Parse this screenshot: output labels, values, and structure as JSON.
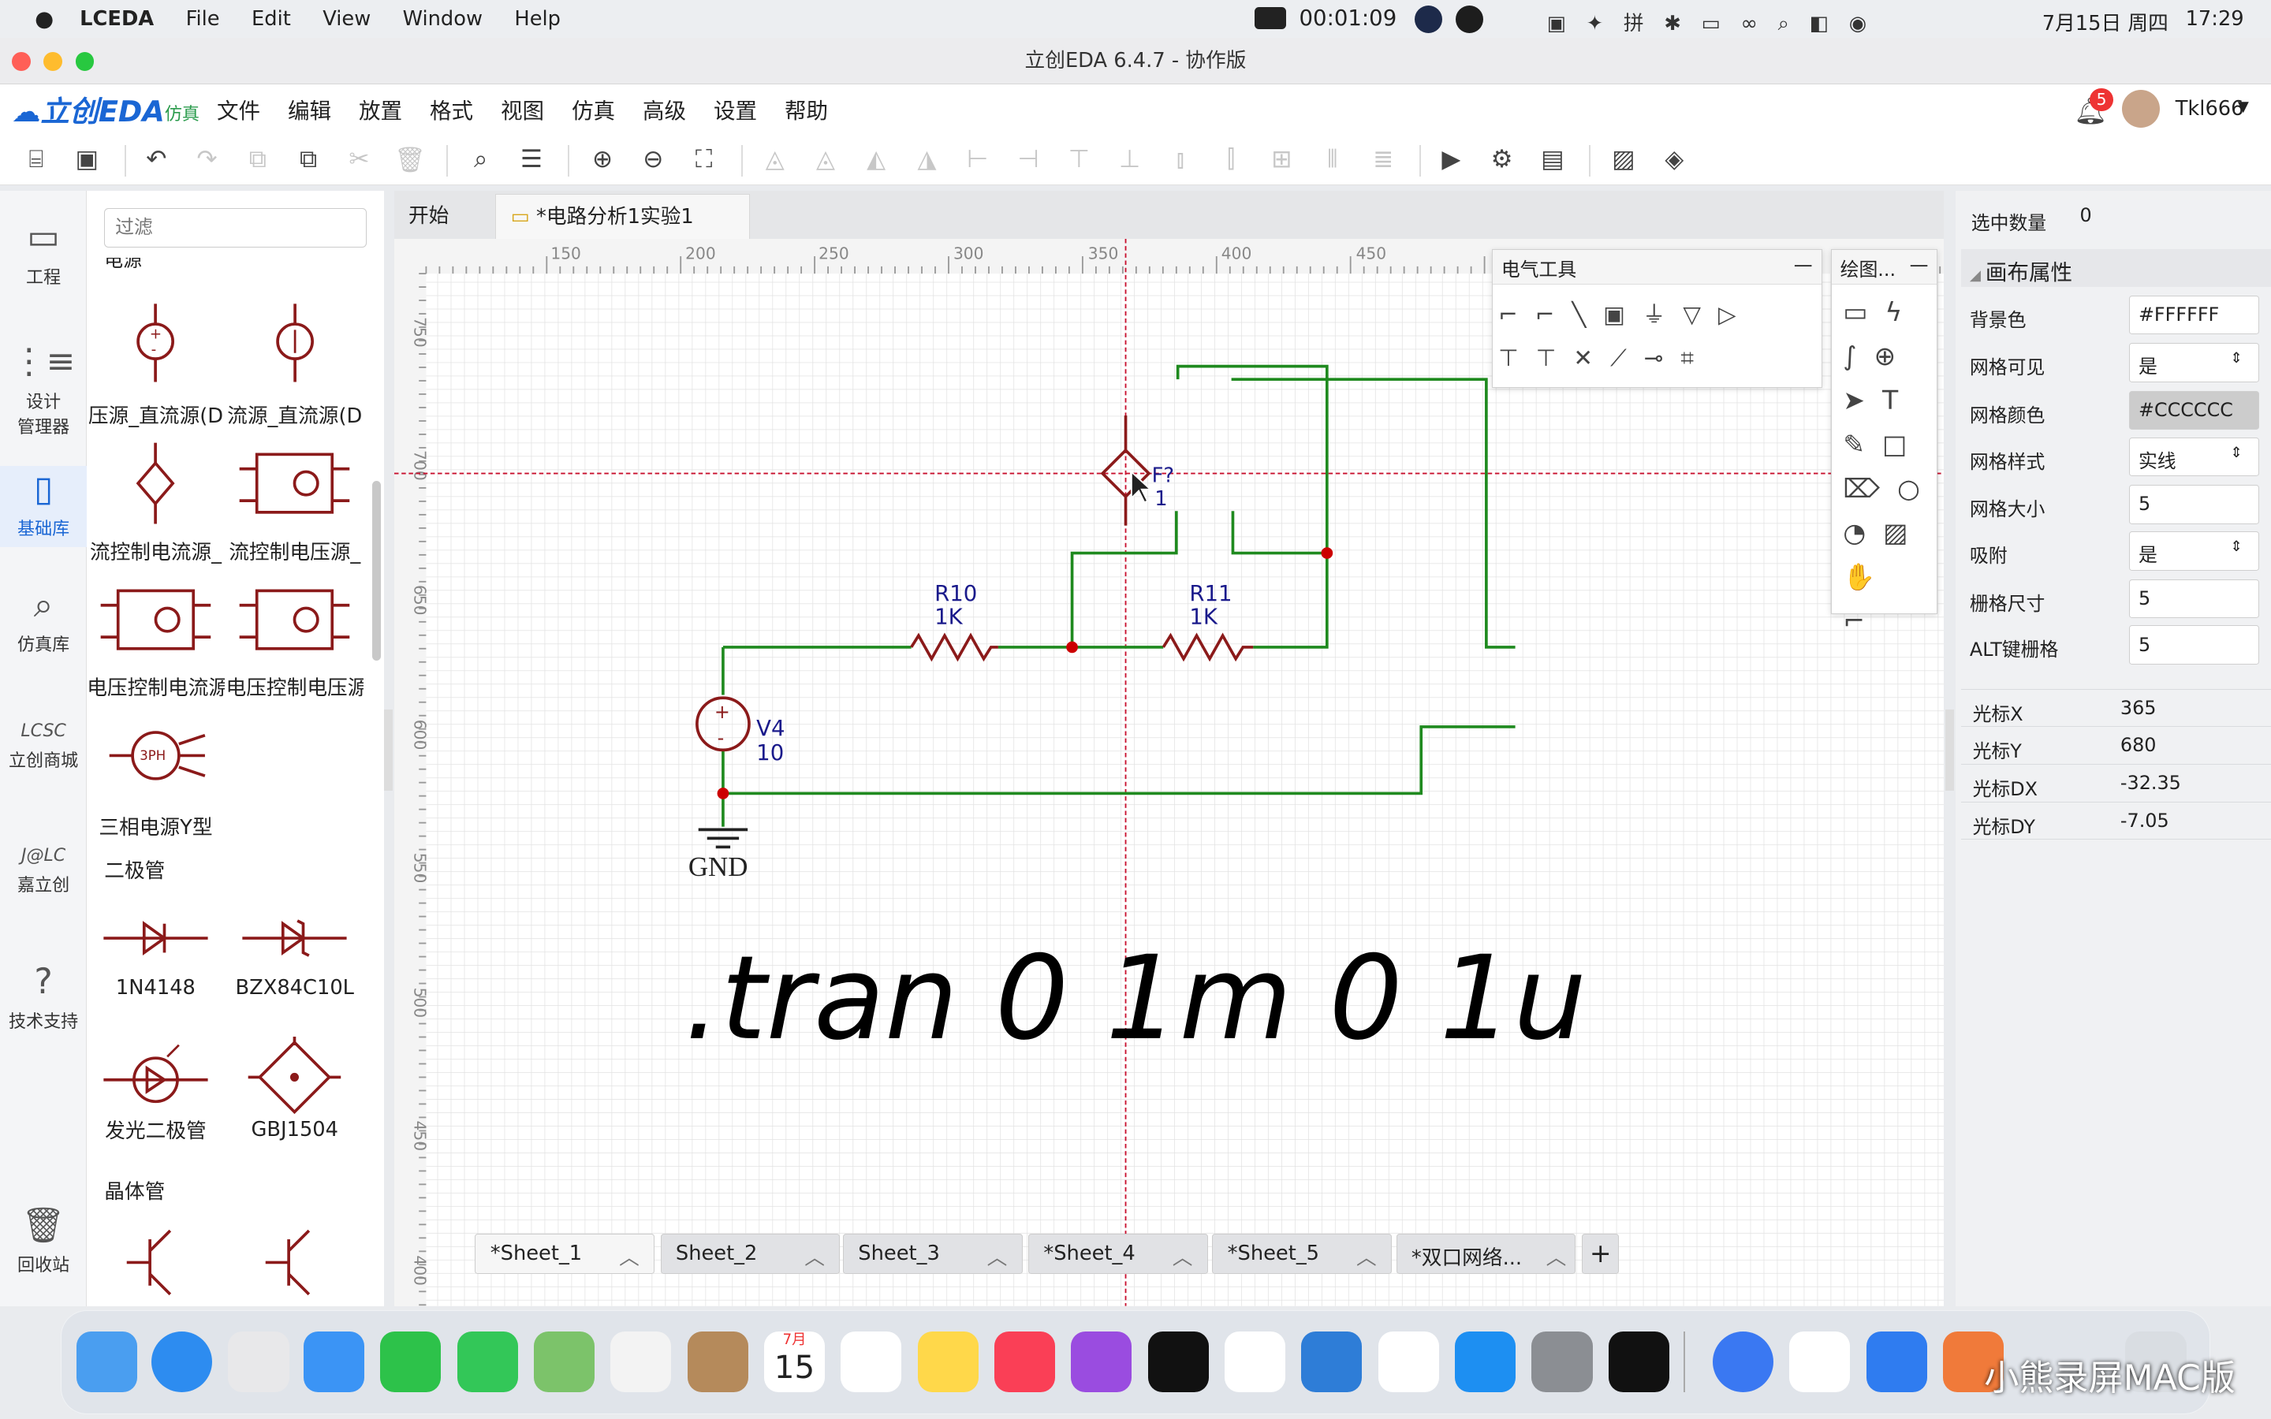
{
  "menubar": {
    "app": "LCEDA",
    "items": [
      "File",
      "Edit",
      "View",
      "Window",
      "Help"
    ],
    "timer": "00:01:09",
    "date": "7月15日 周四",
    "time": "17:29"
  },
  "window": {
    "title": "立创EDA 6.4.7 - 协作版"
  },
  "appmenu": {
    "logo": "立创EDA",
    "logo_tag": "仿真",
    "items": [
      "文件",
      "编辑",
      "放置",
      "格式",
      "视图",
      "仿真",
      "高级",
      "设置",
      "帮助"
    ],
    "notif_count": "5",
    "user": "Tkl666"
  },
  "leftbar": [
    {
      "label": "工程",
      "icon": "folder-icon"
    },
    {
      "label": "设计\n管理器",
      "icon": "design-manager-icon"
    },
    {
      "label": "基础库",
      "icon": "library-icon"
    },
    {
      "label": "仿真库",
      "icon": "sim-lib-icon"
    },
    {
      "label": "立创商城",
      "icon": "lcsc-icon"
    },
    {
      "label": "嘉立创",
      "icon": "jlc-icon"
    },
    {
      "label": "技术支持",
      "icon": "help-icon"
    },
    {
      "label": "回收站",
      "icon": "trash-icon"
    }
  ],
  "library": {
    "filter_placeholder": "过滤",
    "sec_power": "电源",
    "cells": [
      "压源_直流源(D",
      "流源_直流源(D",
      "流控制电流源_",
      "流控制电压源_",
      "电压控制电流源",
      "电压控制电压源",
      "三相电源Y型"
    ],
    "sec_diode": "二极管",
    "diodes": [
      "1N4148",
      "BZX84C10L",
      "发光二极管",
      "GBJ1504"
    ],
    "sec_bjt": "晶体管"
  },
  "tabs": {
    "start": "开始",
    "doc": "*电路分析1实验1"
  },
  "ruler": {
    "top": [
      "150",
      "200",
      "250",
      "300",
      "350",
      "400",
      "450"
    ],
    "left": [
      "750",
      "700",
      "650",
      "600",
      "550",
      "500",
      "450",
      "400"
    ]
  },
  "schematic": {
    "r10": "R10",
    "r10v": "1K",
    "r11": "R11",
    "r11v": "1K",
    "v4": "V4",
    "v4v": "10",
    "f": "F?",
    "fv": "1",
    "gnd": "GND",
    "directive": ".tran 0 1m 0 1u"
  },
  "etools": {
    "title": "电气工具"
  },
  "dtools": {
    "title": "绘图..."
  },
  "props": {
    "sel_label": "选中数量",
    "sel_val": "0",
    "section": "画布属性",
    "rows": [
      {
        "k": "背景色",
        "v": "#FFFFFF"
      },
      {
        "k": "网格可见",
        "v": "是"
      },
      {
        "k": "网格颜色",
        "v": "#CCCCCC"
      },
      {
        "k": "网格样式",
        "v": "实线"
      },
      {
        "k": "网格大小",
        "v": "5"
      },
      {
        "k": "吸附",
        "v": "是"
      },
      {
        "k": "栅格尺寸",
        "v": "5"
      },
      {
        "k": "ALT键栅格",
        "v": "5"
      }
    ],
    "cursor": [
      {
        "k": "光标X",
        "v": "365"
      },
      {
        "k": "光标Y",
        "v": "680"
      },
      {
        "k": "光标DX",
        "v": "-32.35"
      },
      {
        "k": "光标DY",
        "v": "-7.05"
      }
    ]
  },
  "sheets": [
    "*Sheet_1",
    "Sheet_2",
    "Sheet_3",
    "*Sheet_4",
    "*Sheet_5",
    "*双口网络..."
  ],
  "watermark": "小熊录屏MAC版",
  "dock_calendar": {
    "month": "7月",
    "day": "15"
  }
}
